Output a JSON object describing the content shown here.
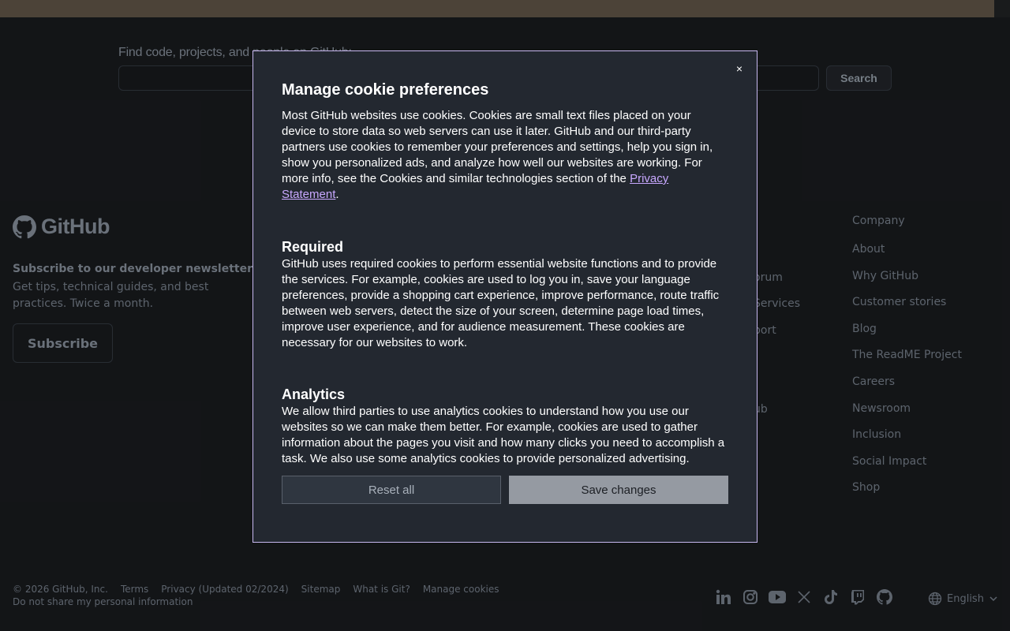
{
  "search": {
    "title": "Find code, projects, and people on GitHub:",
    "button_label": "Search"
  },
  "footer": {
    "logo_text": "GitHub",
    "newsletter_title": "Subscribe to our developer newsletter",
    "newsletter_text": "Get tips, technical guides, and best practices. Twice a month.",
    "subscribe_label": "Subscribe",
    "partial_column": [
      "orum",
      "Services",
      "port",
      "ub"
    ],
    "company": {
      "heading": "Company",
      "items": [
        "About",
        "Why GitHub",
        "Customer stories",
        "Blog",
        "The ReadME Project",
        "Careers",
        "Newsroom",
        "Inclusion",
        "Social Impact",
        "Shop"
      ]
    },
    "copyright": "© 2026 GitHub, Inc.",
    "links": [
      "Terms",
      "Privacy (Updated 02/2024)",
      "Sitemap",
      "What is Git?",
      "Manage cookies"
    ],
    "second_link": "Do not share my personal information",
    "social_icons": [
      "linkedin-icon",
      "instagram-icon",
      "youtube-icon",
      "x-icon",
      "tiktok-icon",
      "twitch-icon",
      "github-icon"
    ],
    "language": "English"
  },
  "modal": {
    "close_label": "×",
    "title": "Manage cookie preferences",
    "intro_text": "Most GitHub websites use cookies. Cookies are small text files placed on your device to store data so web servers can use it later. GitHub and our third-party partners use cookies to remember your preferences and settings, help you sign in, show you personalized ads, and analyze how well our websites are working. For more info, see the Cookies and similar technologies section of the ",
    "privacy_link": "Privacy Statement",
    "intro_end": ".",
    "required_title": "Required",
    "required_text": "GitHub uses required cookies to perform essential website functions and to provide the services. For example, cookies are used to log you in, save your language preferences, provide a shopping cart experience, improve performance, route traffic between web servers, detect the size of your screen, determine page load times, improve user experience, and for audience measurement. These cookies are necessary for our websites to work.",
    "analytics_title": "Analytics",
    "analytics_text": "We allow third parties to use analytics cookies to understand how you use our websites so we can make them better. For example, cookies are used to gather information about the pages you visit and how many clicks you need to accomplish a task. We also use some analytics cookies to provide personalized advertising.",
    "reset_label": "Reset all",
    "save_label": "Save changes"
  },
  "colors": {
    "modal_bg": "#232830",
    "modal_border": "#c8b8f0",
    "link": "#c8a8ff",
    "save_bg": "#959aa2"
  }
}
